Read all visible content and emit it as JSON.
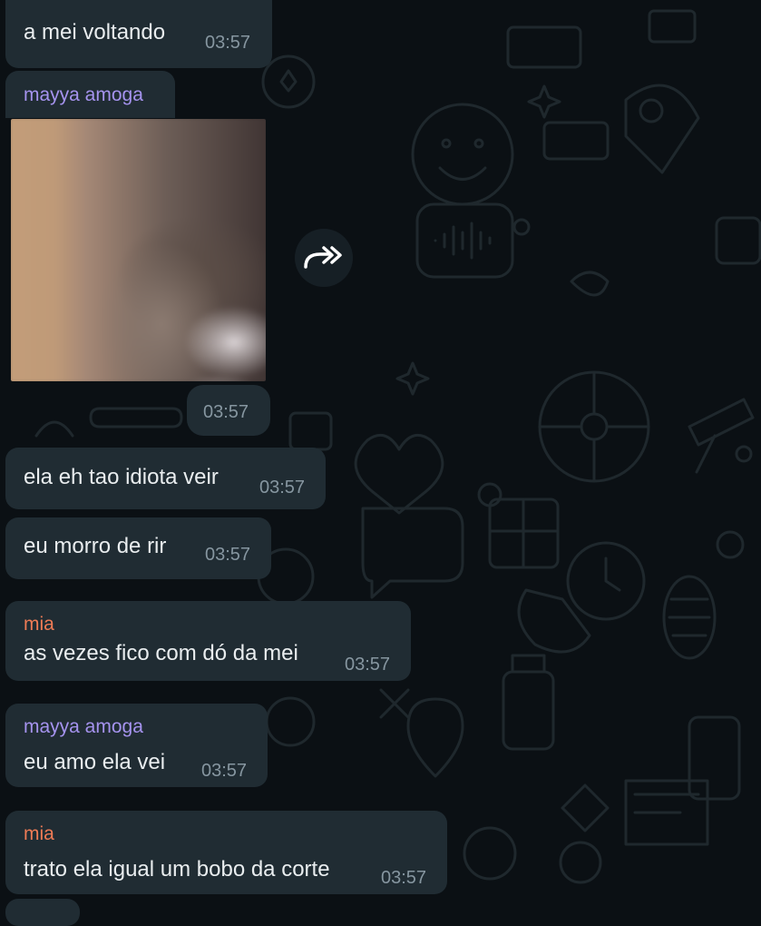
{
  "messages": [
    {
      "text": "a mei voltando",
      "time": "03:57"
    },
    {
      "sender": "mayya amoga",
      "type": "image",
      "time": "03:57"
    },
    {
      "text": "ela eh tao idiota veir",
      "time": "03:57"
    },
    {
      "text": "eu morro de rir",
      "time": "03:57"
    },
    {
      "sender": "mia",
      "text": "as vezes fico com dó da mei",
      "time": "03:57"
    },
    {
      "sender": "mayya amoga",
      "text": "eu amo ela vei",
      "time": "03:57"
    },
    {
      "sender": "mia",
      "text": "trato ela igual um bobo da corte",
      "time": "03:57"
    }
  ],
  "colors": {
    "background": "#0b1014",
    "bubble": "#202c33",
    "sender_mayya": "#a593ee",
    "sender_mia": "#ef7b55",
    "time": "#8696a0"
  },
  "icons": {
    "forward_button": "forward-icon"
  }
}
